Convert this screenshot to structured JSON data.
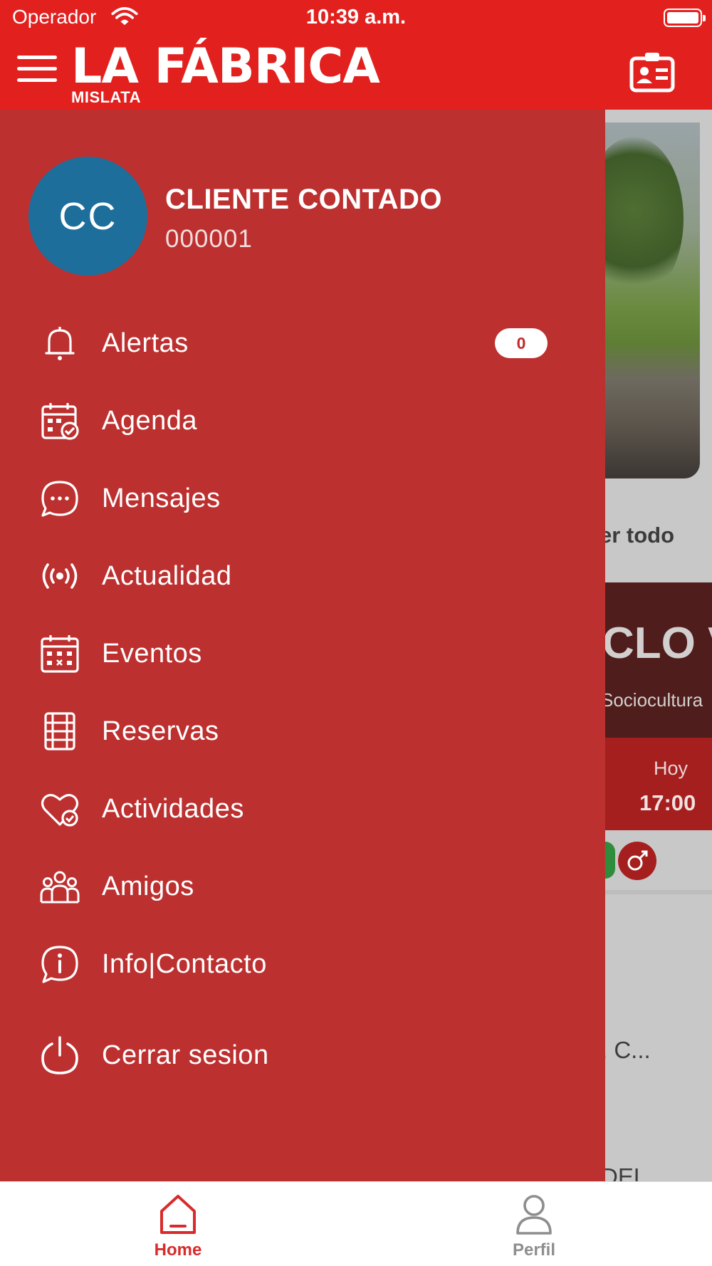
{
  "status_bar": {
    "carrier": "Operador",
    "time": "10:39 a.m."
  },
  "header": {
    "logo_main": "LA FÁBRICA",
    "logo_sub": "MISLATA",
    "colors": {
      "brand_red": "#e2211f"
    },
    "menu_icon": "hamburger-icon",
    "right_icon": "id-card-icon"
  },
  "user": {
    "initials": "CC",
    "name": "CLIENTE CONTADO",
    "code": "000001",
    "avatar_color": "#1d6e9b"
  },
  "menu": {
    "items": [
      {
        "label": "Alertas",
        "icon": "bell-icon",
        "badge": "0"
      },
      {
        "label": "Agenda",
        "icon": "calendar-check-icon"
      },
      {
        "label": "Mensajes",
        "icon": "chat-bubble-icon"
      },
      {
        "label": "Actualidad",
        "icon": "broadcast-icon"
      },
      {
        "label": "Eventos",
        "icon": "calendar-grid-icon"
      },
      {
        "label": "Reservas",
        "icon": "film-strip-icon"
      },
      {
        "label": "Actividades",
        "icon": "heart-check-icon"
      },
      {
        "label": "Amigos",
        "icon": "group-icon"
      },
      {
        "label": "Info|Contacto",
        "icon": "info-chat-icon"
      },
      {
        "label": "Cerrar sesion",
        "icon": "power-icon"
      }
    ]
  },
  "background": {
    "ver_todo": "er todo",
    "banner_title": "CLO V",
    "banner_sub": "Sociocultura",
    "day": "Hoy",
    "time": "17:00",
    "text_c": ", C...",
    "text_del": "DEL"
  },
  "tabbar": {
    "tabs": [
      {
        "label": "Home",
        "icon": "home-icon",
        "active": true
      },
      {
        "label": "Perfil",
        "icon": "user-icon",
        "active": false
      }
    ]
  }
}
